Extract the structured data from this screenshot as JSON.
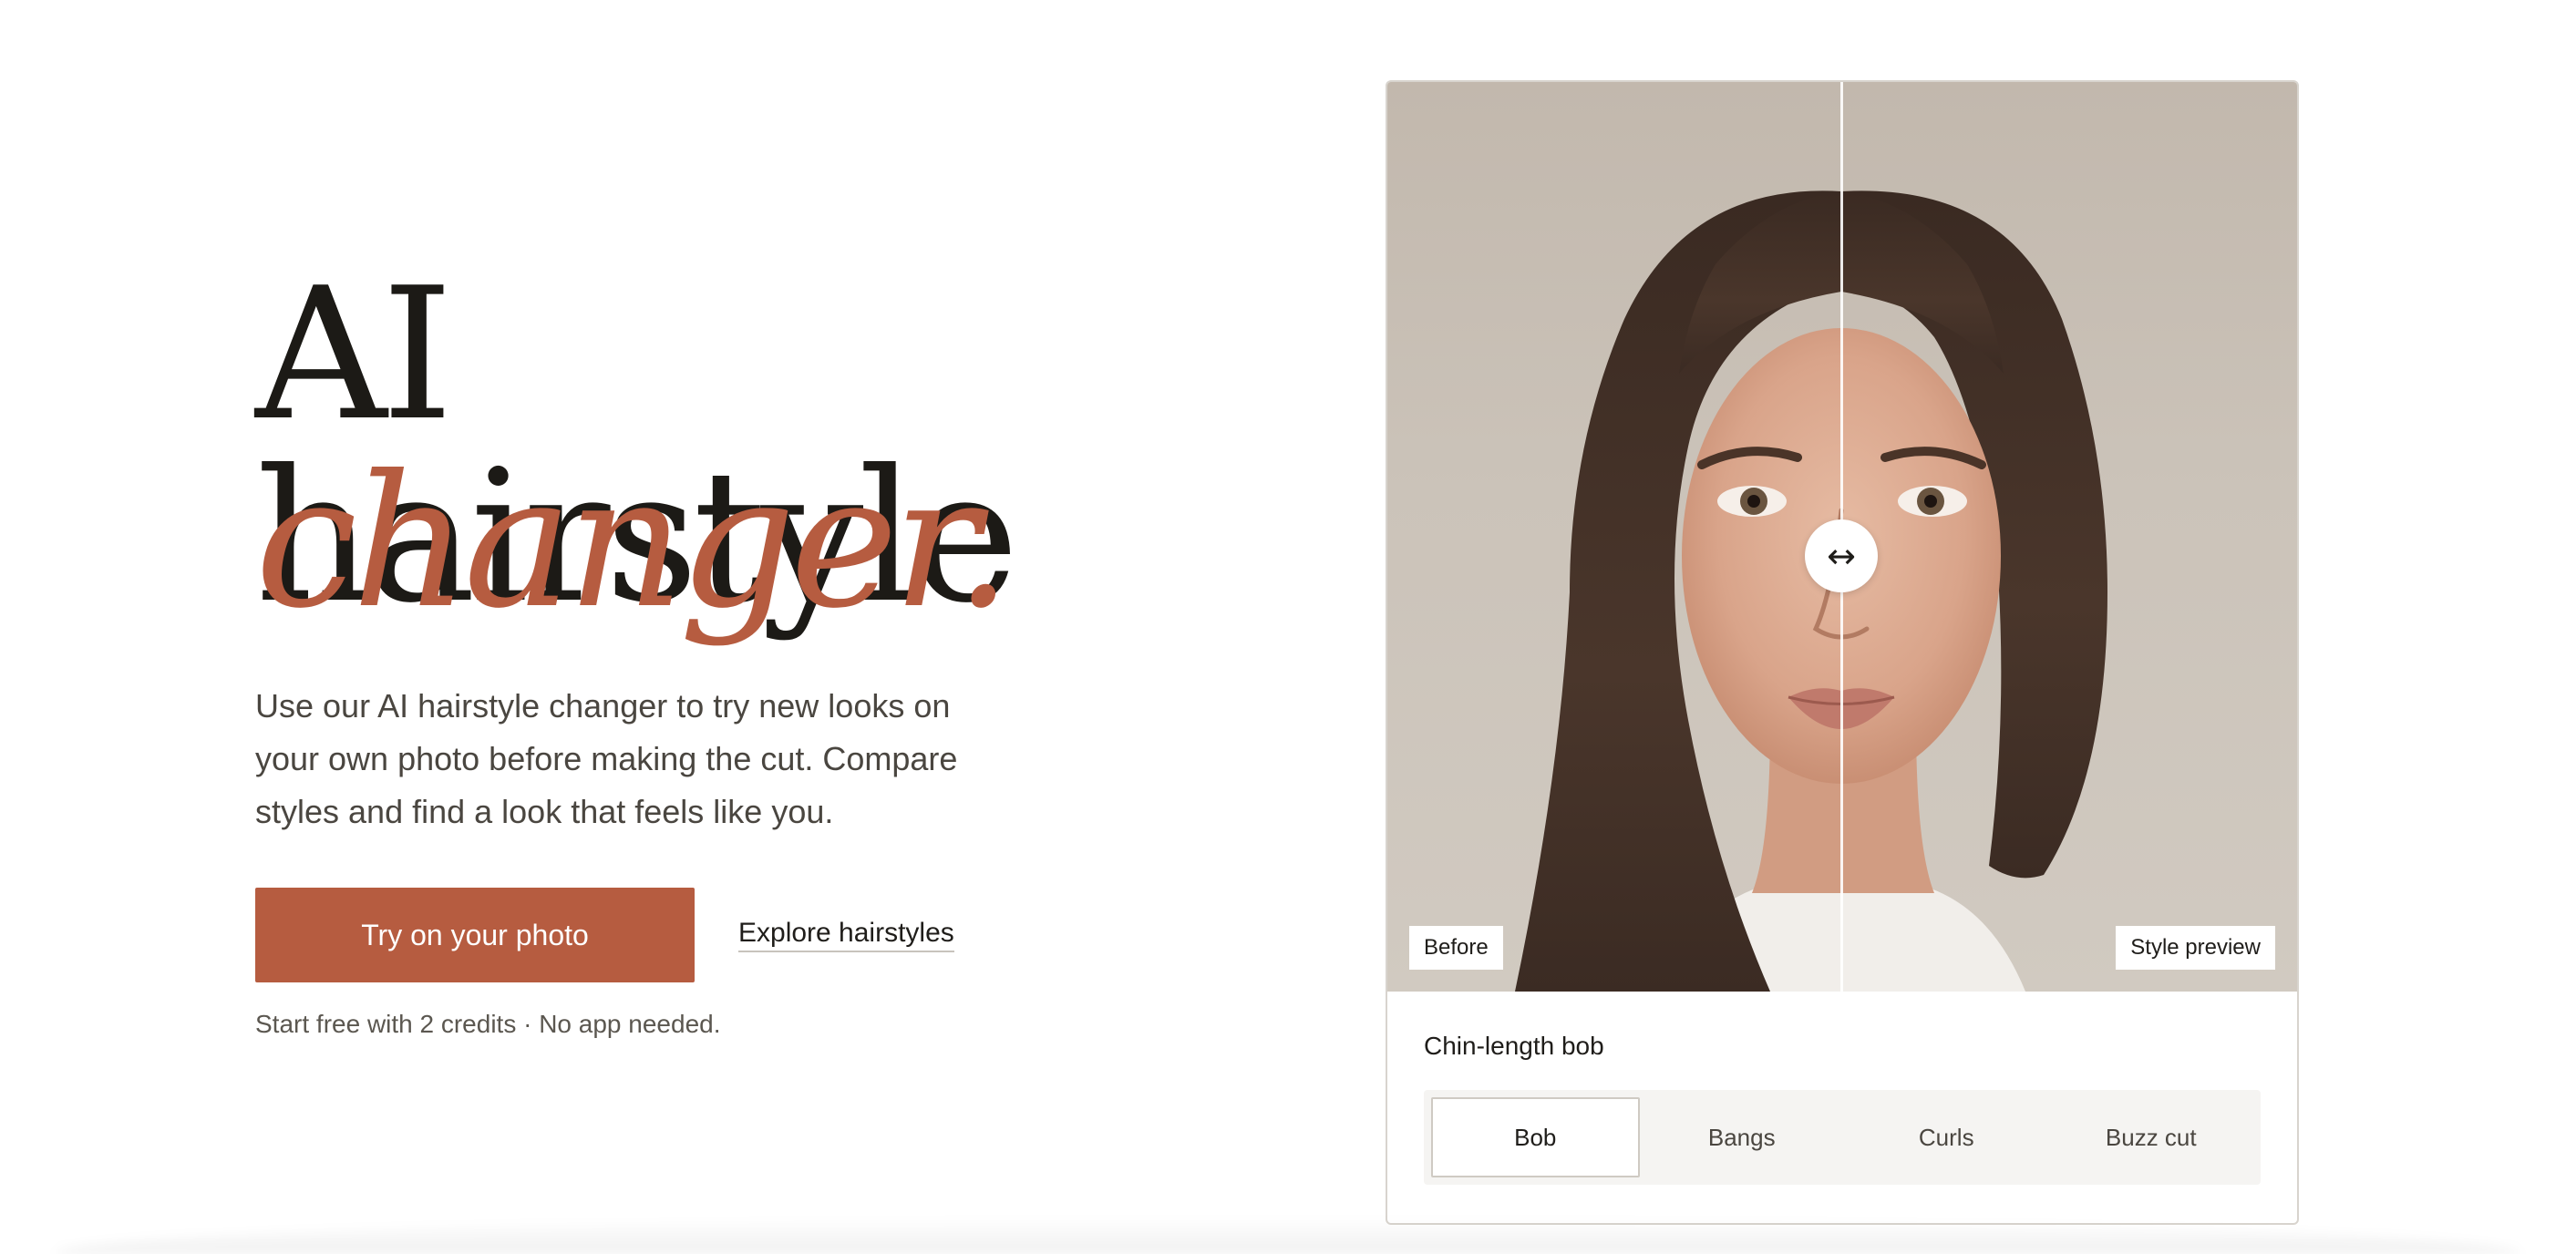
{
  "hero": {
    "headline_line1": "AI hairstyle",
    "headline_line2": "changer.",
    "subtitle": "Use our AI hairstyle changer to try new looks on your own photo before making the cut. Compare styles and find a look that feels like you.",
    "primary_button": "Try on your photo",
    "secondary_link": "Explore hairstyles",
    "fineprint": "Start free with 2 credits · No app needed."
  },
  "comparison": {
    "before_label": "Before",
    "after_label": "Style preview",
    "handle_icon": "↔",
    "selected_style": "Chin-length bob",
    "tabs": [
      {
        "label": "Bob",
        "active": true
      },
      {
        "label": "Bangs",
        "active": false
      },
      {
        "label": "Curls",
        "active": false
      },
      {
        "label": "Buzz cut",
        "active": false
      }
    ]
  },
  "colors": {
    "accent": "#b65c40",
    "text_dark": "#1c1a16",
    "text_muted": "#4a4640"
  }
}
